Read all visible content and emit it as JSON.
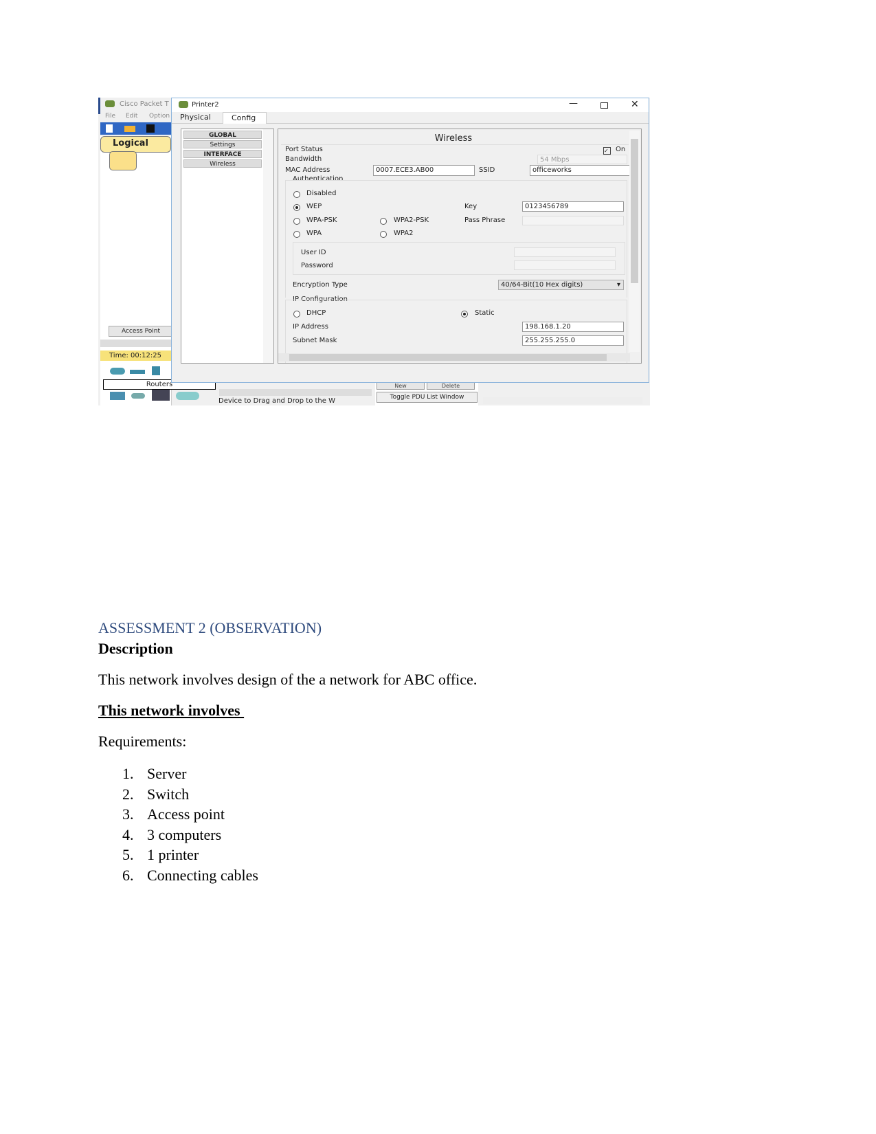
{
  "screenshot": {
    "main_window_title": "Cisco Packet T",
    "menu": [
      "File",
      "Edit",
      "Option"
    ],
    "logical_tab": "Logical",
    "access_point_label": "Access Point",
    "time": "Time: 00:12:25",
    "device_category": "Routers",
    "device_hint": "Device to Drag and Drop to the W",
    "pdu_buttons": [
      "New",
      "Delete"
    ],
    "toggle_pdu": "Toggle PDU List Window",
    "dialog": {
      "title": "Printer2",
      "tabs": [
        "Physical",
        "Config"
      ],
      "active_tab": "Config",
      "nav": [
        "GLOBAL",
        "Settings",
        "INTERFACE",
        "Wireless"
      ],
      "panel_title": "Wireless",
      "port_status_label": "Port Status",
      "port_status_value": "On",
      "bandwidth_label": "Bandwidth",
      "bandwidth_value": "54 Mbps",
      "mac_label": "MAC Address",
      "mac_value": "0007.ECE3.AB00",
      "ssid_label": "SSID",
      "ssid_value": "officeworks",
      "auth_label": "Authentication",
      "auth_options": [
        "Disabled",
        "WEP",
        "WPA-PSK",
        "WPA2-PSK",
        "WPA",
        "WPA2"
      ],
      "auth_selected": "WEP",
      "key_label": "Key",
      "key_value": "0123456789",
      "passphrase_label": "Pass Phrase",
      "userid_label": "User ID",
      "password_label": "Password",
      "enc_label": "Encryption Type",
      "enc_value": "40/64-Bit(10 Hex digits)",
      "ipconf_label": "IP Configuration",
      "dhcp_label": "DHCP",
      "static_label": "Static",
      "ip_mode_selected": "Static",
      "ip_label": "IP Address",
      "ip_value": "198.168.1.20",
      "mask_label": "Subnet Mask",
      "mask_value": "255.255.255.0"
    }
  },
  "document": {
    "heading": "ASSESSMENT 2 (OBSERVATION)",
    "heading_color": "#2e4a7d",
    "subheading": "Description",
    "paragraph": "This network involves design of the a network for ABC office.",
    "underlined": "This network involves ",
    "requirements_label": "Requirements:",
    "requirements": [
      "Server",
      "Switch",
      "Access point",
      "3 computers",
      "1 printer",
      "Connecting cables"
    ]
  }
}
